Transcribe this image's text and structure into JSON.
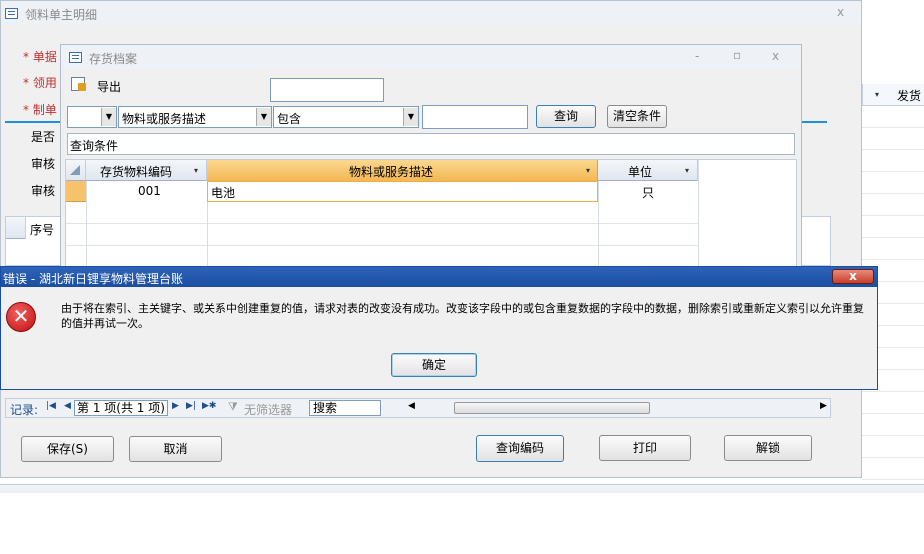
{
  "main_window": {
    "title": "领料单主明细",
    "close": "x",
    "form_labels": [
      "* 单据",
      "* 领用",
      "* 制单",
      "是否",
      "审核",
      "审核"
    ],
    "right_header_col": "发货",
    "subtable_header": "序号",
    "record_nav": {
      "label": "记录:",
      "position": "第 1 项(共 1 项)",
      "filter": "无筛选器",
      "search": "搜索"
    },
    "buttons": {
      "save": "保存(S)",
      "cancel": "取消",
      "query_code": "查询编码",
      "print": "打印",
      "unlock": "解锁"
    }
  },
  "inventory_window": {
    "title": "存货档案",
    "controls": [
      "-",
      "▫",
      "x"
    ],
    "export_label": "导出",
    "filter": {
      "field_value": "物料或服务描述",
      "operator_value": "包含",
      "query_button": "查询",
      "clear_button": "清空条件"
    },
    "query_conditions_label": "查询条件",
    "table": {
      "columns": [
        "存货物料编码",
        "物料或服务描述",
        "单位"
      ],
      "rows": [
        {
          "code": "001",
          "description": "电池",
          "unit": "只"
        }
      ]
    }
  },
  "error_dialog": {
    "title": "错误 - 湖北新日锂享物料管理台账",
    "message": "由于将在索引、主关键字、或关系中创建重复的值，请求对表的改变没有成功。改变该字段中的或包含重复数据的字段中的数据，删除索引或重新定义索引以允许重复的值并再试一次。",
    "ok_button": "确定",
    "close": "x"
  },
  "colors": {
    "dialog_title_bar": "#1b4ea3",
    "error_red": "#d01818",
    "selected_header": "#f6c26b",
    "required_star": "#d03030",
    "divider_blue": "#1e8fd9"
  }
}
